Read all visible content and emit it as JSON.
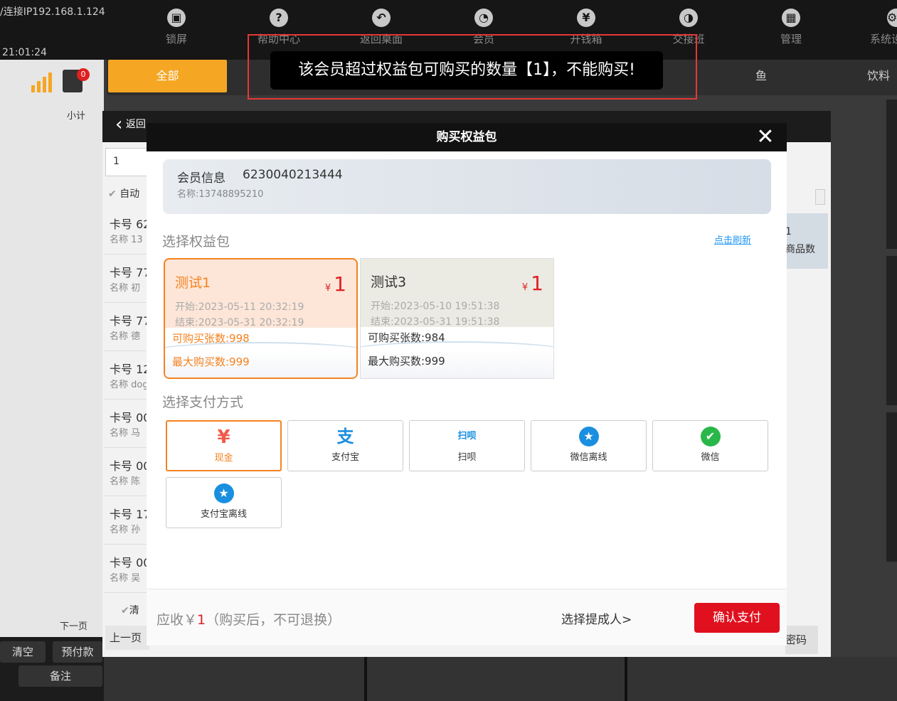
{
  "topbar": {
    "ip": "/连接IP192.168.1.124",
    "clock": "21:01:24",
    "buttons": [
      {
        "label": "锁屏",
        "icon": "lock-icon"
      },
      {
        "label": "帮助中心",
        "icon": "help-icon"
      },
      {
        "label": "返回桌面",
        "icon": "back-icon"
      },
      {
        "label": "会员",
        "icon": "member-icon"
      },
      {
        "label": "开钱箱",
        "icon": "cashbox-icon"
      },
      {
        "label": "交接班",
        "icon": "handover-icon"
      },
      {
        "label": "管理",
        "icon": "manage-icon"
      },
      {
        "label": "系统设",
        "icon": "settings-icon"
      }
    ]
  },
  "categories": {
    "all": "全部",
    "fish": "鱼",
    "drinks": "饮料"
  },
  "left": {
    "badge": "0",
    "subtotal": "小计",
    "next_page": "下一页",
    "clear": "清空",
    "prepay": "预付款",
    "note": "备注"
  },
  "member_list": {
    "back": "返回",
    "search_value": "1",
    "auto_label": "自动",
    "clear_label": "清",
    "prev_page": "上一页",
    "rows": [
      {
        "a": "卡号 62",
        "b": "名称 13"
      },
      {
        "a": "卡号 77",
        "b": "名称 初"
      },
      {
        "a": "卡号 77",
        "b": "名称 德"
      },
      {
        "a": "卡号 12",
        "b": "名称 dog"
      },
      {
        "a": "卡号 00",
        "b": "名称 马"
      },
      {
        "a": "卡号 00",
        "b": "名称 陈"
      },
      {
        "a": "卡号 17",
        "b": "名称 孙"
      },
      {
        "a": "卡号 00",
        "b": "名称 吴"
      }
    ],
    "right_count": "1",
    "right_label": "商品数",
    "pwd": "密码"
  },
  "toast": "该会员超过权益包可购买的数量【1】，不能购买!",
  "dialog": {
    "title": "购买权益包",
    "member_info_label": "会员信息",
    "member_card_no": "6230040213444",
    "member_name": "名称:13748895210",
    "section_packages": "选择权益包",
    "refresh": "点击刷新",
    "packages": [
      {
        "name": "测试1",
        "currency": "¥",
        "price": "1",
        "start": "开始:2023-05-11 20:32:19",
        "end": "结束:2023-05-31 20:32:19",
        "count": "可购买张数:998",
        "max": "最大购买数:999",
        "selected": true
      },
      {
        "name": "测试3",
        "currency": "¥",
        "price": "1",
        "start": "开始:2023-05-10 19:51:38",
        "end": "结束:2023-05-31 19:51:38",
        "count": "可购买张数:984",
        "max": "最大购买数:999",
        "selected": false
      }
    ],
    "section_payment": "选择支付方式",
    "payments": [
      {
        "label": "现金",
        "icon": "yuan-icon",
        "color": "#f05a4a"
      },
      {
        "label": "支付宝",
        "icon": "alipay-icon",
        "color": "#1a8fe0"
      },
      {
        "label": "扫呗",
        "icon": "saobei-icon",
        "color": "#1a8fe0"
      },
      {
        "label": "微信离线",
        "icon": "star-icon",
        "color": "#1a8fe0"
      },
      {
        "label": "微信",
        "icon": "wechat-check-icon",
        "color": "#2ab74a"
      },
      {
        "label": "支付宝离线",
        "icon": "star-icon",
        "color": "#1a8fe0"
      }
    ],
    "due_prefix": "应收￥",
    "due_amount": "1",
    "due_suffix": "（购买后，不可退换）",
    "staff": "选择提成人>",
    "confirm": "确认支付"
  }
}
